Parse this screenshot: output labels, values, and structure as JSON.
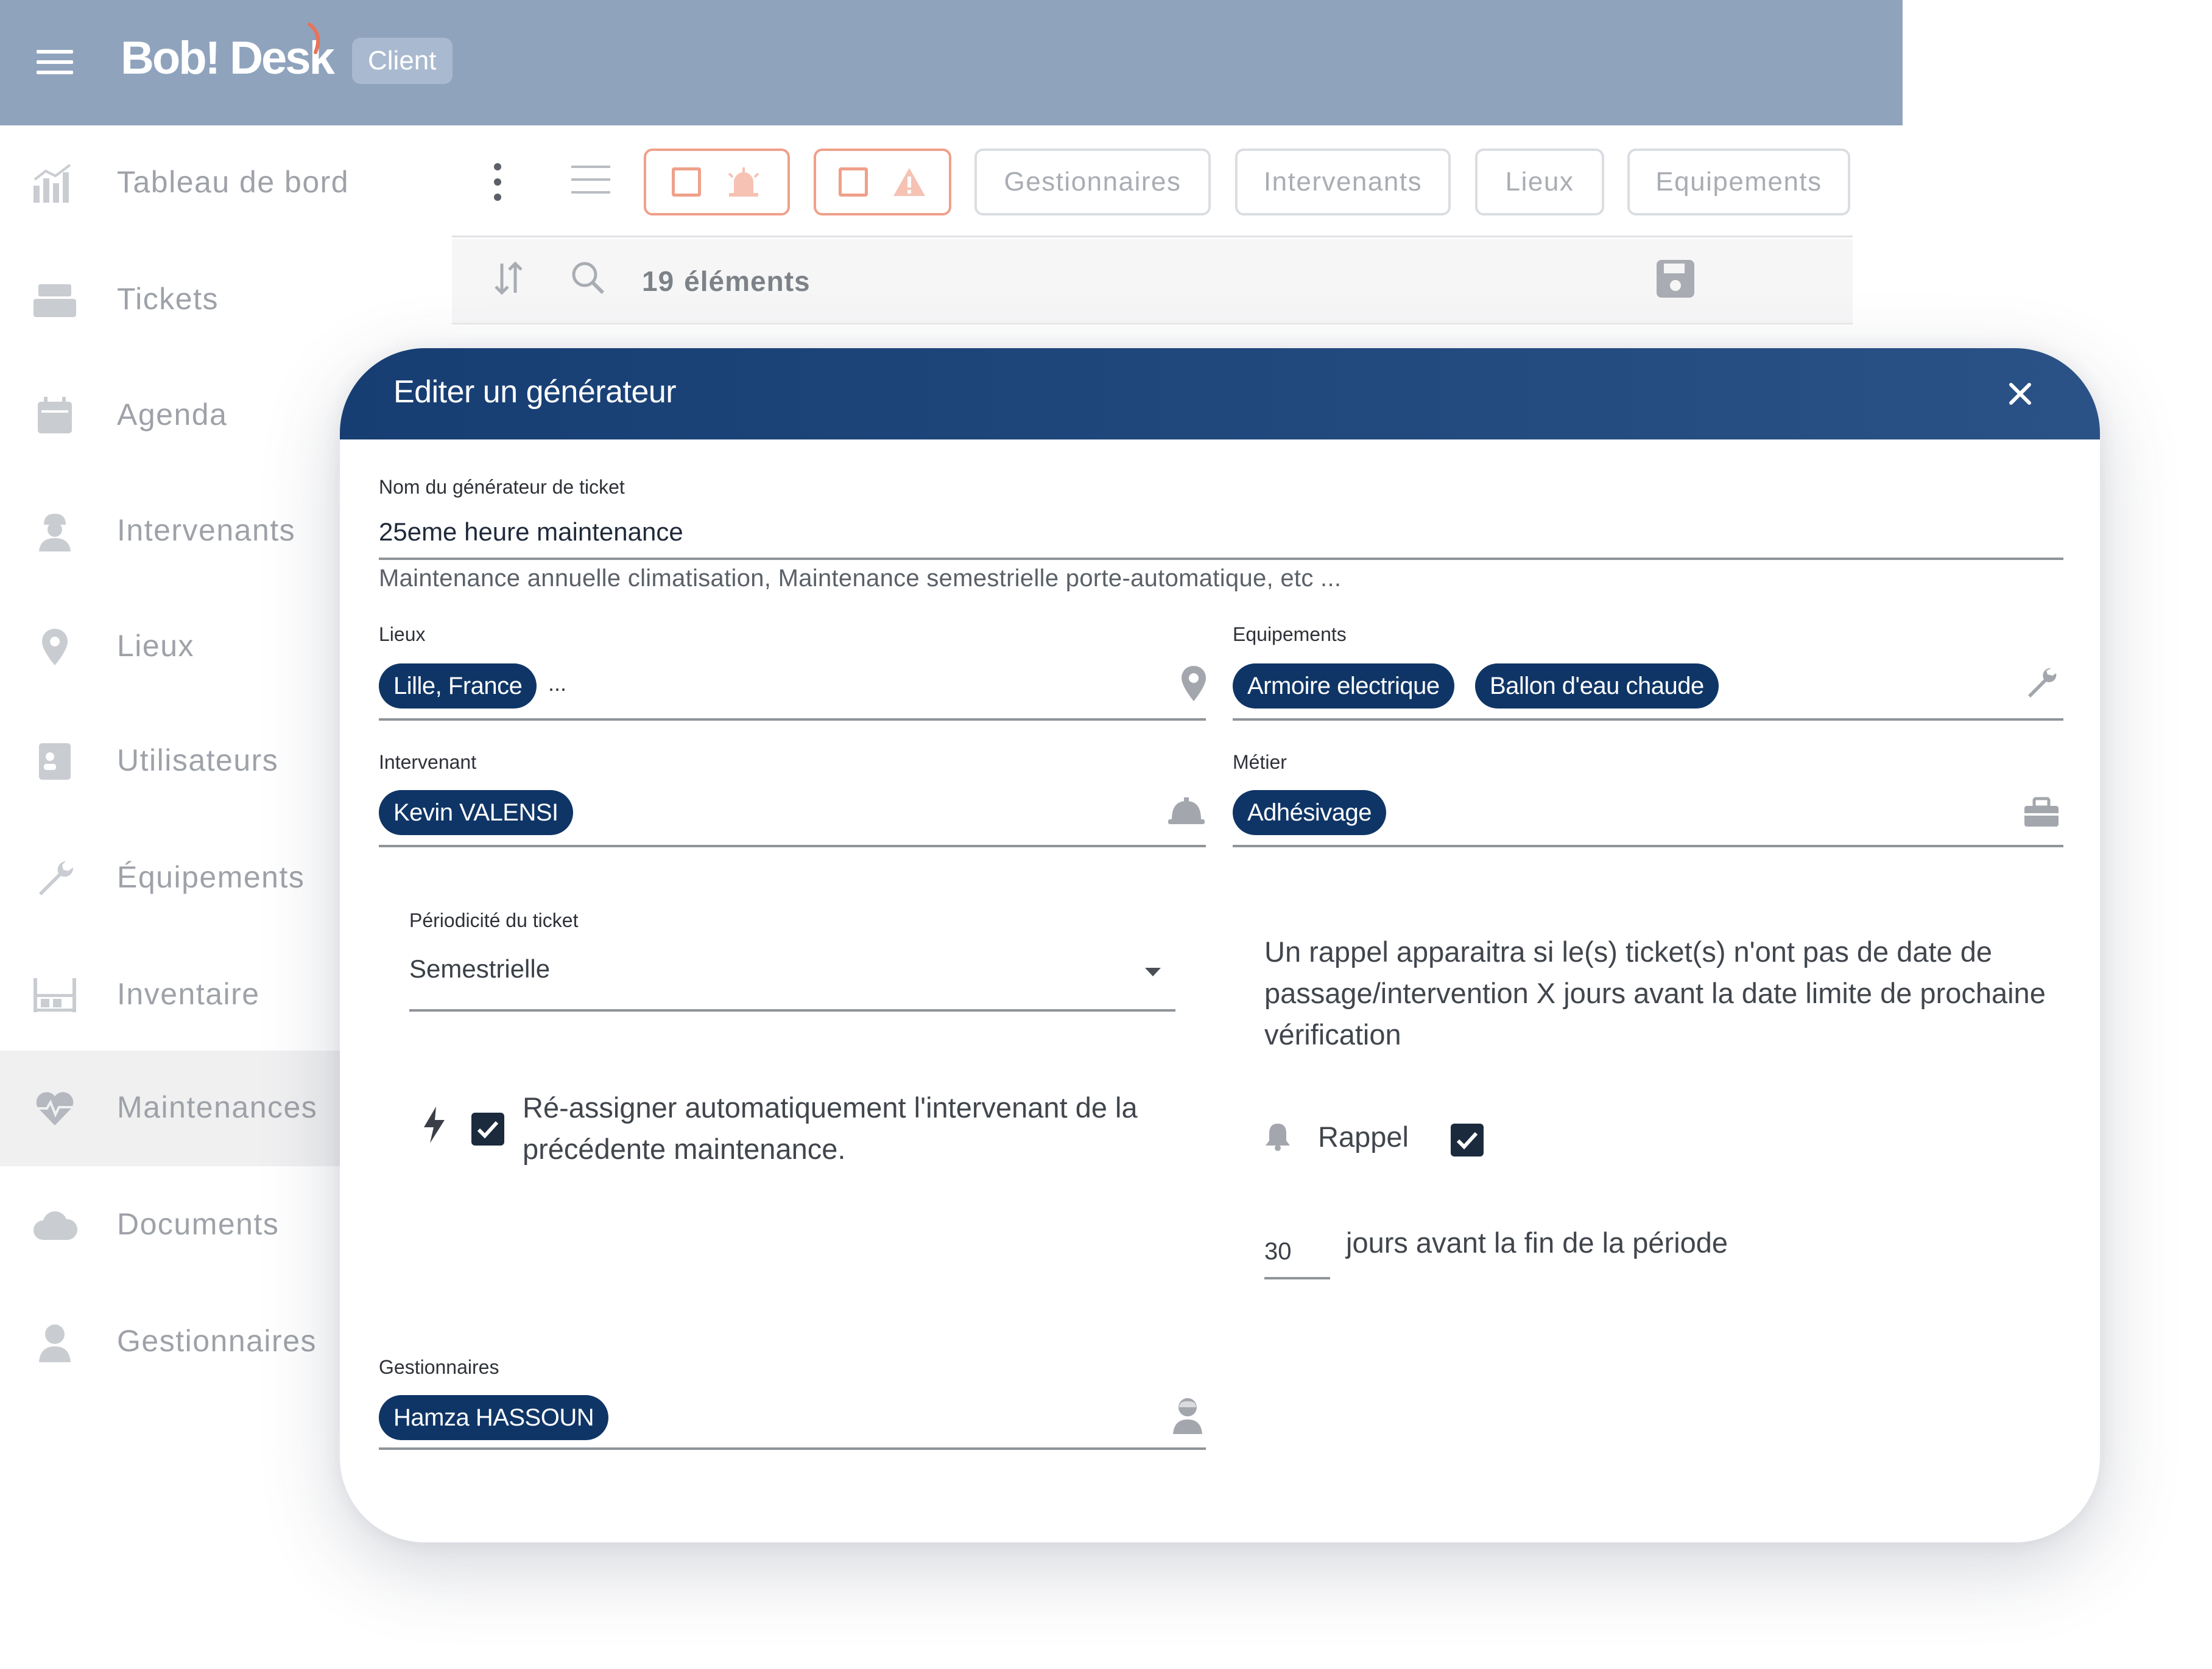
{
  "app": {
    "logo_text": "Bob! Desk",
    "role_badge": "Client"
  },
  "sidebar": {
    "items": [
      {
        "label": "Tableau de bord"
      },
      {
        "label": "Tickets"
      },
      {
        "label": "Agenda"
      },
      {
        "label": "Intervenants"
      },
      {
        "label": "Lieux"
      },
      {
        "label": "Utilisateurs"
      },
      {
        "label": "Équipements"
      },
      {
        "label": "Inventaire"
      },
      {
        "label": "Maintenances",
        "active": true
      },
      {
        "label": "Documents"
      },
      {
        "label": "Gestionnaires"
      }
    ]
  },
  "toolbar": {
    "filters": [
      "Gestionnaires",
      "Intervenants",
      "Lieux",
      "Equipements"
    ],
    "count_number": "19",
    "count_label": "éléments"
  },
  "modal": {
    "title": "Editer un générateur",
    "name_label": "Nom du générateur de ticket",
    "name_value": "25eme heure maintenance",
    "name_hint": "Maintenance annuelle climatisation, Maintenance semestrielle porte-automatique, etc ...",
    "lieux_label": "Lieux",
    "lieux_chips": [
      "Lille, France"
    ],
    "lieux_more": "...",
    "equipements_label": "Equipements",
    "equipements_chips": [
      "Armoire electrique",
      "Ballon d'eau chaude"
    ],
    "intervenant_label": "Intervenant",
    "intervenant_chips": [
      "Kevin VALENSI"
    ],
    "metier_label": "Métier",
    "metier_chips": [
      "Adhésivage"
    ],
    "periodicite_label": "Périodicité du ticket",
    "periodicite_value": "Semestrielle",
    "reassign_text": "Ré-assigner automatiquement l'intervenant de la précédente maintenance.",
    "reassign_checked": true,
    "rappel_info": "Un rappel apparaitra si le(s) ticket(s) n'ont pas de date de passage/intervention X jours avant la date limite de prochaine vérification",
    "rappel_label": "Rappel",
    "rappel_checked": true,
    "days_value": "30",
    "days_suffix": "jours avant la fin de la période",
    "gestionnaires_label": "Gestionnaires",
    "gestionnaires_chips": [
      "Hamza HASSOUN"
    ]
  },
  "colors": {
    "header_bg": "#8fa3bd",
    "modal_header": "#173e73",
    "chip_bg": "#0f3566",
    "alert_orange": "#f0a08a"
  }
}
